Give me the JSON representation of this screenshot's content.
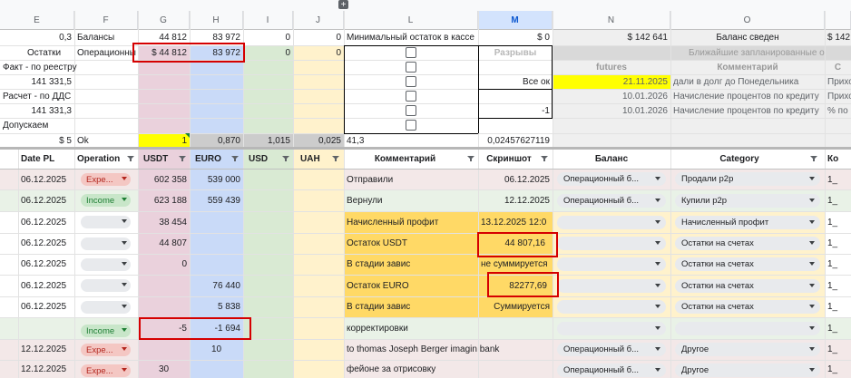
{
  "toolbar": {
    "add_icon": "plus-icon"
  },
  "columns": [
    "E",
    "F",
    "G",
    "H",
    "I",
    "J",
    "L",
    "M",
    "N",
    "O"
  ],
  "summary": {
    "r1": {
      "e": "0,3",
      "f": "Балансы",
      "g": "44 812",
      "h": "83 972",
      "i": "0",
      "j": "0",
      "l": "Минимальный остаток в кассе",
      "m": "$ 0",
      "n": "$ 142 641",
      "o": "Баланс сведен",
      "p": "$ 142"
    },
    "r2": {
      "e": "Остатки",
      "f": "Операционны",
      "g": "$ 44 812",
      "h": "83 972",
      "i": "0",
      "j": "0",
      "m": "Разрывы",
      "no": "Ближайшие запланированные о"
    },
    "r3": {
      "e": "Факт - по реестру",
      "n": "futures",
      "o": "Комментарий",
      "p": "С"
    },
    "r4": {
      "e": "141 331,5",
      "m": "Все ок",
      "n": "21.11.2025",
      "o": "дали в долг до Понедельника",
      "p": "Прихо"
    },
    "r5": {
      "e": "Расчет - по ДДС",
      "n": "10.01.2026",
      "o": "Начисление процентов по кредиту",
      "p": "Прихо"
    },
    "r6": {
      "e": "141 331,3",
      "m": "-1",
      "n": "10.01.2026",
      "o": "Начисление процентов по кредиту",
      "p": "% по"
    },
    "r7": {
      "e": "Допускаем"
    },
    "r8": {
      "e": "$ 5",
      "f": "Ok",
      "g": "1",
      "h": "0,870",
      "i": "1,015",
      "j": "0,025",
      "l": "41,3",
      "m": "0,02457627119"
    }
  },
  "headers": {
    "d": "Date PL",
    "f": "Operation",
    "g": "USDT",
    "h": "EURO",
    "i": "USD",
    "j": "UAH",
    "l": "Комментарий",
    "m": "Скриншот",
    "n": "Баланс",
    "o": "Category",
    "p": "Ко"
  },
  "rows": [
    {
      "date": "06.12.2025",
      "op": "Expe...",
      "usdt": "602 358",
      "euro": "539 000",
      "comment": "Отправили",
      "shot": "06.12.2025",
      "bal": "Операционный б...",
      "cat": "Продали p2p",
      "k": "1_"
    },
    {
      "date": "06.12.2025",
      "op": "Income",
      "usdt": "623 188",
      "euro": "559 439",
      "comment": "Вернули",
      "shot": "12.12.2025",
      "bal": "Операционный б...",
      "cat": "Купили p2p",
      "k": "1_"
    },
    {
      "date": "06.12.2025",
      "op": "",
      "usdt": "38 454",
      "euro": "",
      "comment": "Начисленный профит",
      "shot": "13.12.2025 12:0",
      "bal": "",
      "cat": "Начисленный профит",
      "k": "1_"
    },
    {
      "date": "06.12.2025",
      "op": "",
      "usdt": "44 807",
      "euro": "",
      "comment": "Остаток USDT",
      "shot": "44 807,16",
      "bal": "",
      "cat": "Остатки на счетах",
      "k": "1_"
    },
    {
      "date": "06.12.2025",
      "op": "",
      "usdt": "0",
      "euro": "",
      "comment": "В стадии завис",
      "shot": "не суммируется",
      "bal": "",
      "cat": "Остатки на счетах",
      "k": "1_"
    },
    {
      "date": "06.12.2025",
      "op": "",
      "usdt": "",
      "euro": "76 440",
      "comment": "Остаток EURO",
      "shot": "82277,69",
      "bal": "",
      "cat": "Остатки на счетах",
      "k": "1_"
    },
    {
      "date": "06.12.2025",
      "op": "",
      "usdt": "",
      "euro": "5 838",
      "comment": "В стадии завис",
      "shot": "Суммируется",
      "bal": "",
      "cat": "Остатки на счетах",
      "k": "1_"
    },
    {
      "date": "",
      "op": "Income",
      "usdt": "-5",
      "euro": "-1 694",
      "comment": "корректировки",
      "shot": "",
      "bal": "",
      "cat": "",
      "k": "1_"
    },
    {
      "date": "12.12.2025",
      "op": "Expe...",
      "usdt": "",
      "euro": "10",
      "comment": "to thomas Joseph Berger imagin bank",
      "shot": "",
      "bal": "Операционный б...",
      "cat": "Другое",
      "k": "1_"
    },
    {
      "date": "12.12.2025",
      "op": "Expe...",
      "usdt": "30",
      "euro": "",
      "comment": "фейоне за отрисовку",
      "shot": "",
      "bal": "Операционный б...",
      "cat": "Другое",
      "k": "1_"
    }
  ],
  "colors": {
    "pink": "#ead1dc",
    "blue": "#c9daf8",
    "green": "#d9ead3",
    "yellow_light": "#fff2cc",
    "orange": "#ffd966",
    "yellow": "#ffff00",
    "red_outline": "#d50000",
    "expense_chip": "#f4c7c3",
    "income_chip": "#c8e6c9"
  }
}
